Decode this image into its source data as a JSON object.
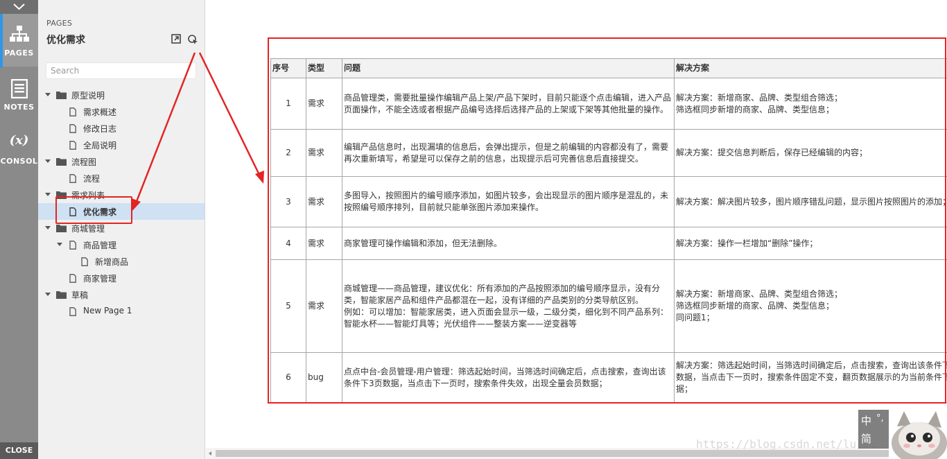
{
  "rail": {
    "pages_label": "PAGES",
    "notes_label": "NOTES",
    "console_symbol": "(x)",
    "console_label": "CONSOL",
    "close_label": "CLOSE"
  },
  "panel": {
    "kicker": "PAGES",
    "title": "优化需求",
    "search_placeholder": "Search",
    "tree": [
      {
        "label": "原型说明",
        "type": "folder"
      },
      {
        "label": "需求概述",
        "type": "page"
      },
      {
        "label": "修改日志",
        "type": "page"
      },
      {
        "label": "全局说明",
        "type": "page"
      },
      {
        "label": "流程图",
        "type": "folder"
      },
      {
        "label": "流程",
        "type": "page"
      },
      {
        "label": "需求列表",
        "type": "folder"
      },
      {
        "label": "优化需求",
        "type": "page",
        "selected": true
      },
      {
        "label": "商城管理",
        "type": "folder"
      },
      {
        "label": "商品管理",
        "type": "page"
      },
      {
        "label": "新增商品",
        "type": "page"
      },
      {
        "label": "商家管理",
        "type": "page"
      },
      {
        "label": "草稿",
        "type": "folder"
      },
      {
        "label": "New Page 1",
        "type": "page"
      }
    ]
  },
  "table": {
    "headers": [
      "序号",
      "类型",
      "问题",
      "解决方案"
    ],
    "rows": [
      {
        "no": "1",
        "type": "需求",
        "issue": "商品管理类，需要批量操作编辑产品上架/产品下架时，目前只能逐个点击编辑，进入产品页面操作，不能全选或者根据产品编号选择后选择产品的上架或下架等其他批量的操作。",
        "solution": "解决方案：新增商家、品牌、类型组合筛选；\n筛选框同步新增的商家、品牌、类型信息；"
      },
      {
        "no": "2",
        "type": "需求",
        "issue": "编辑产品信息时，出现漏填的信息后，会弹出提示，但是之前编辑的内容都没有了，需要再次重新填写，希望是可以保存之前的信息，出现提示后可完善信息后直接提交。",
        "solution": "解决方案：提交信息判断后，保存已经编辑的内容；"
      },
      {
        "no": "3",
        "type": "需求",
        "issue": "多图导入，按照图片的编号顺序添加，如图片较多，会出现显示的图片顺序是混乱的，未按照编号顺序排列，目前就只能单张图片添加来操作。",
        "solution": "解决方案：解决图片较多，图片顺序错乱问题，显示图片按照图片的添加；bug"
      },
      {
        "no": "4",
        "type": "需求",
        "issue": "商家管理可操作编辑和添加，但无法删除。",
        "solution": "解决方案：操作一栏增加“删除”操作；"
      },
      {
        "no": "5",
        "type": "需求",
        "issue": "商城管理——商品管理，建议优化：所有添加的产品按照添加的编号顺序显示，没有分类，智能家居产品和组件产品都混在一起，没有详细的产品类别的分类导航区别。\n例如：可以增加：智能家居类，进入页面会显示一级，二级分类，细化到不同产品系列：智能水杯——智能灯具等；光伏组件——整装方案——逆变器等",
        "solution": "解决方案：新增商家、品牌、类型组合筛选；\n筛选框同步新增的商家、品牌、类型信息；\n同问题1；"
      },
      {
        "no": "6",
        "type": "bug",
        "issue": "点点中台-会员管理-用户管理：筛选起始时间，当筛选时间确定后，点击搜索，查询出该条件下3页数据，当点击下一页时，搜索条件失效，出现全量会员数据；",
        "solution": "解决方案：筛选起始时间，当筛选时间确定后，点击搜索，查询出该条件下3页数据，当点击下一页时，搜索条件固定不变，翻页数据展示的为当前条件下的数据；"
      }
    ]
  },
  "ime": {
    "char1": "中",
    "char2": "°,",
    "char3": "简"
  },
  "watermark": "https://blog.csdn.net/lu..."
}
